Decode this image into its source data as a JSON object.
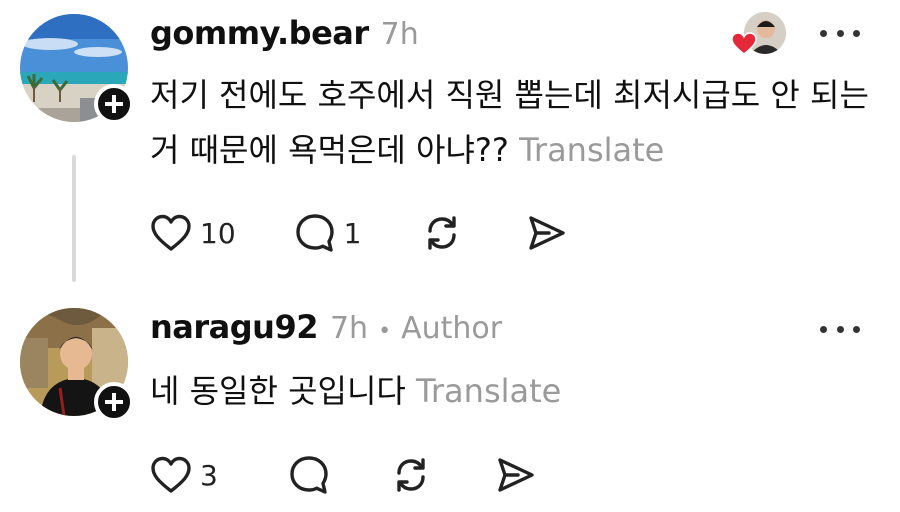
{
  "posts": [
    {
      "username": "gommy.bear",
      "time": "7h",
      "text": "저기 전에도 호주에서 직원 뽑는데 최저시급도 안 되는거 때문에 욕먹은데 아냐??",
      "translate": "Translate",
      "likes": "10",
      "replies": "1",
      "avatar_icon": "beach-avatar",
      "liked_by_icon": "heart-icon"
    },
    {
      "username": "naragu92",
      "time": "7h",
      "separator": "•",
      "tag": "Author",
      "text": "네 동일한 곳입니다",
      "translate": "Translate",
      "likes": "3",
      "avatar_icon": "person-avatar"
    }
  ],
  "colors": {
    "text": "#101010",
    "muted": "#9a9a9a",
    "heart": "#e5283a",
    "badge": "#111111"
  }
}
